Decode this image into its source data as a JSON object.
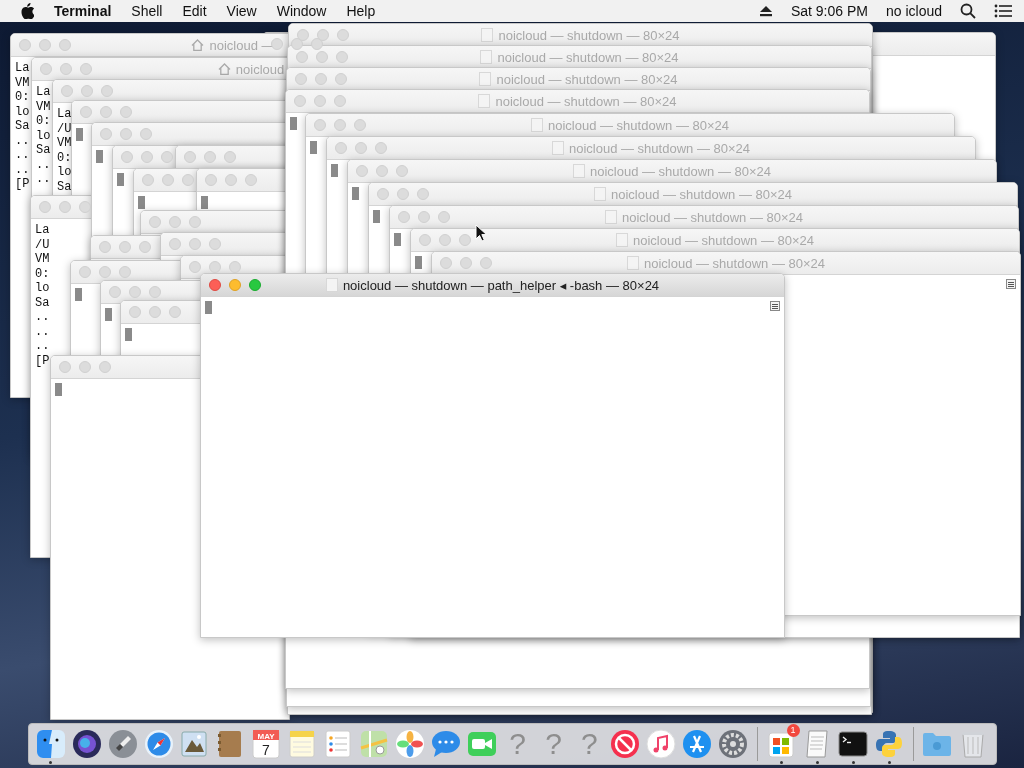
{
  "menu_bar": {
    "app_name": "Terminal",
    "menus": [
      "Shell",
      "Edit",
      "View",
      "Window",
      "Help"
    ],
    "clock": "Sat 9:06 PM",
    "user": "no icloud"
  },
  "windows": [
    {
      "kind": "covered"
    },
    {
      "kind": "output",
      "title": "noicloud —",
      "lines": [
        "La",
        "VM",
        "0:",
        "lo",
        "Sa",
        "..",
        "..",
        "..",
        "[P"
      ]
    },
    {
      "kind": "output",
      "title": "noicloud",
      "lines": [
        "La",
        "VM",
        "0:",
        "lo",
        "Sa",
        "..",
        ".."
      ]
    },
    {
      "kind": "output",
      "lines": [
        "La",
        "/U",
        "VM",
        "0:",
        "lo",
        "Sa"
      ]
    },
    {
      "kind": "prompt"
    },
    {
      "kind": "output",
      "lines": [
        "La",
        "/U",
        "VM",
        "0:",
        "lo",
        "Sa",
        "..",
        "..",
        "..",
        "[P"
      ]
    },
    {
      "kind": "prompt"
    },
    {
      "kind": "prompt"
    },
    {
      "kind": "prompt"
    },
    {
      "kind": "prompt"
    },
    {
      "kind": "prompt"
    },
    {
      "kind": "prompt"
    },
    {
      "kind": "prompt"
    },
    {
      "kind": "prompt"
    },
    {
      "kind": "prompt"
    },
    {
      "kind": "prompt"
    },
    {
      "kind": "prompt"
    },
    {
      "kind": "prompt"
    },
    {
      "kind": "prompt"
    },
    {
      "kind": "covered",
      "title": "noicloud — shutdown — 80×24"
    },
    {
      "kind": "covered",
      "title": "noicloud — shutdown — 80×24"
    },
    {
      "kind": "covered",
      "title": "noicloud — shutdown — 80×24"
    },
    {
      "kind": "prompt",
      "title": "noicloud — shutdown — 80×24"
    },
    {
      "kind": "prompt",
      "title": "noicloud — shutdown — 80×24"
    },
    {
      "kind": "prompt",
      "title": "noicloud — shutdown — 80×24"
    },
    {
      "kind": "prompt",
      "title": "noicloud — shutdown — 80×24"
    },
    {
      "kind": "prompt",
      "title": "noicloud — shutdown — 80×24"
    },
    {
      "kind": "prompt",
      "title": "noicloud — shutdown — 80×24"
    },
    {
      "kind": "prompt",
      "title": "noicloud — shutdown — 80×24"
    },
    {
      "kind": "prompt",
      "title": "noicloud — shutdown — 80×24",
      "marker": true
    },
    {
      "kind": "front",
      "title": "noicloud — shutdown — path_helper ◂ -bash — 80×24",
      "marker": true
    }
  ],
  "dock": {
    "items": [
      {
        "kind": "finder",
        "running": true
      },
      {
        "kind": "siri",
        "running": false
      },
      {
        "kind": "launchpad",
        "running": false
      },
      {
        "kind": "safari",
        "running": false
      },
      {
        "kind": "preview",
        "running": false
      },
      {
        "kind": "contacts",
        "running": false
      },
      {
        "kind": "calendar",
        "running": false,
        "month": "MAY",
        "day": "7"
      },
      {
        "kind": "notes",
        "running": false
      },
      {
        "kind": "reminders",
        "running": false
      },
      {
        "kind": "maps",
        "running": false
      },
      {
        "kind": "photos",
        "running": false
      },
      {
        "kind": "messages",
        "running": false
      },
      {
        "kind": "facetime",
        "running": false
      },
      {
        "kind": "missing",
        "running": false,
        "label": "?"
      },
      {
        "kind": "missing",
        "running": false,
        "label": "?"
      },
      {
        "kind": "missing",
        "running": false,
        "label": "?"
      },
      {
        "kind": "news",
        "running": false
      },
      {
        "kind": "music",
        "running": false
      },
      {
        "kind": "appstore",
        "running": false
      },
      {
        "kind": "settings",
        "running": false
      },
      {
        "kind": "separator"
      },
      {
        "kind": "store",
        "running": true,
        "badge": "1"
      },
      {
        "kind": "textedit",
        "running": true
      },
      {
        "kind": "terminal",
        "running": true
      },
      {
        "kind": "python",
        "running": true
      },
      {
        "kind": "separator"
      },
      {
        "kind": "folder",
        "running": false
      },
      {
        "kind": "trash",
        "running": false
      }
    ]
  }
}
